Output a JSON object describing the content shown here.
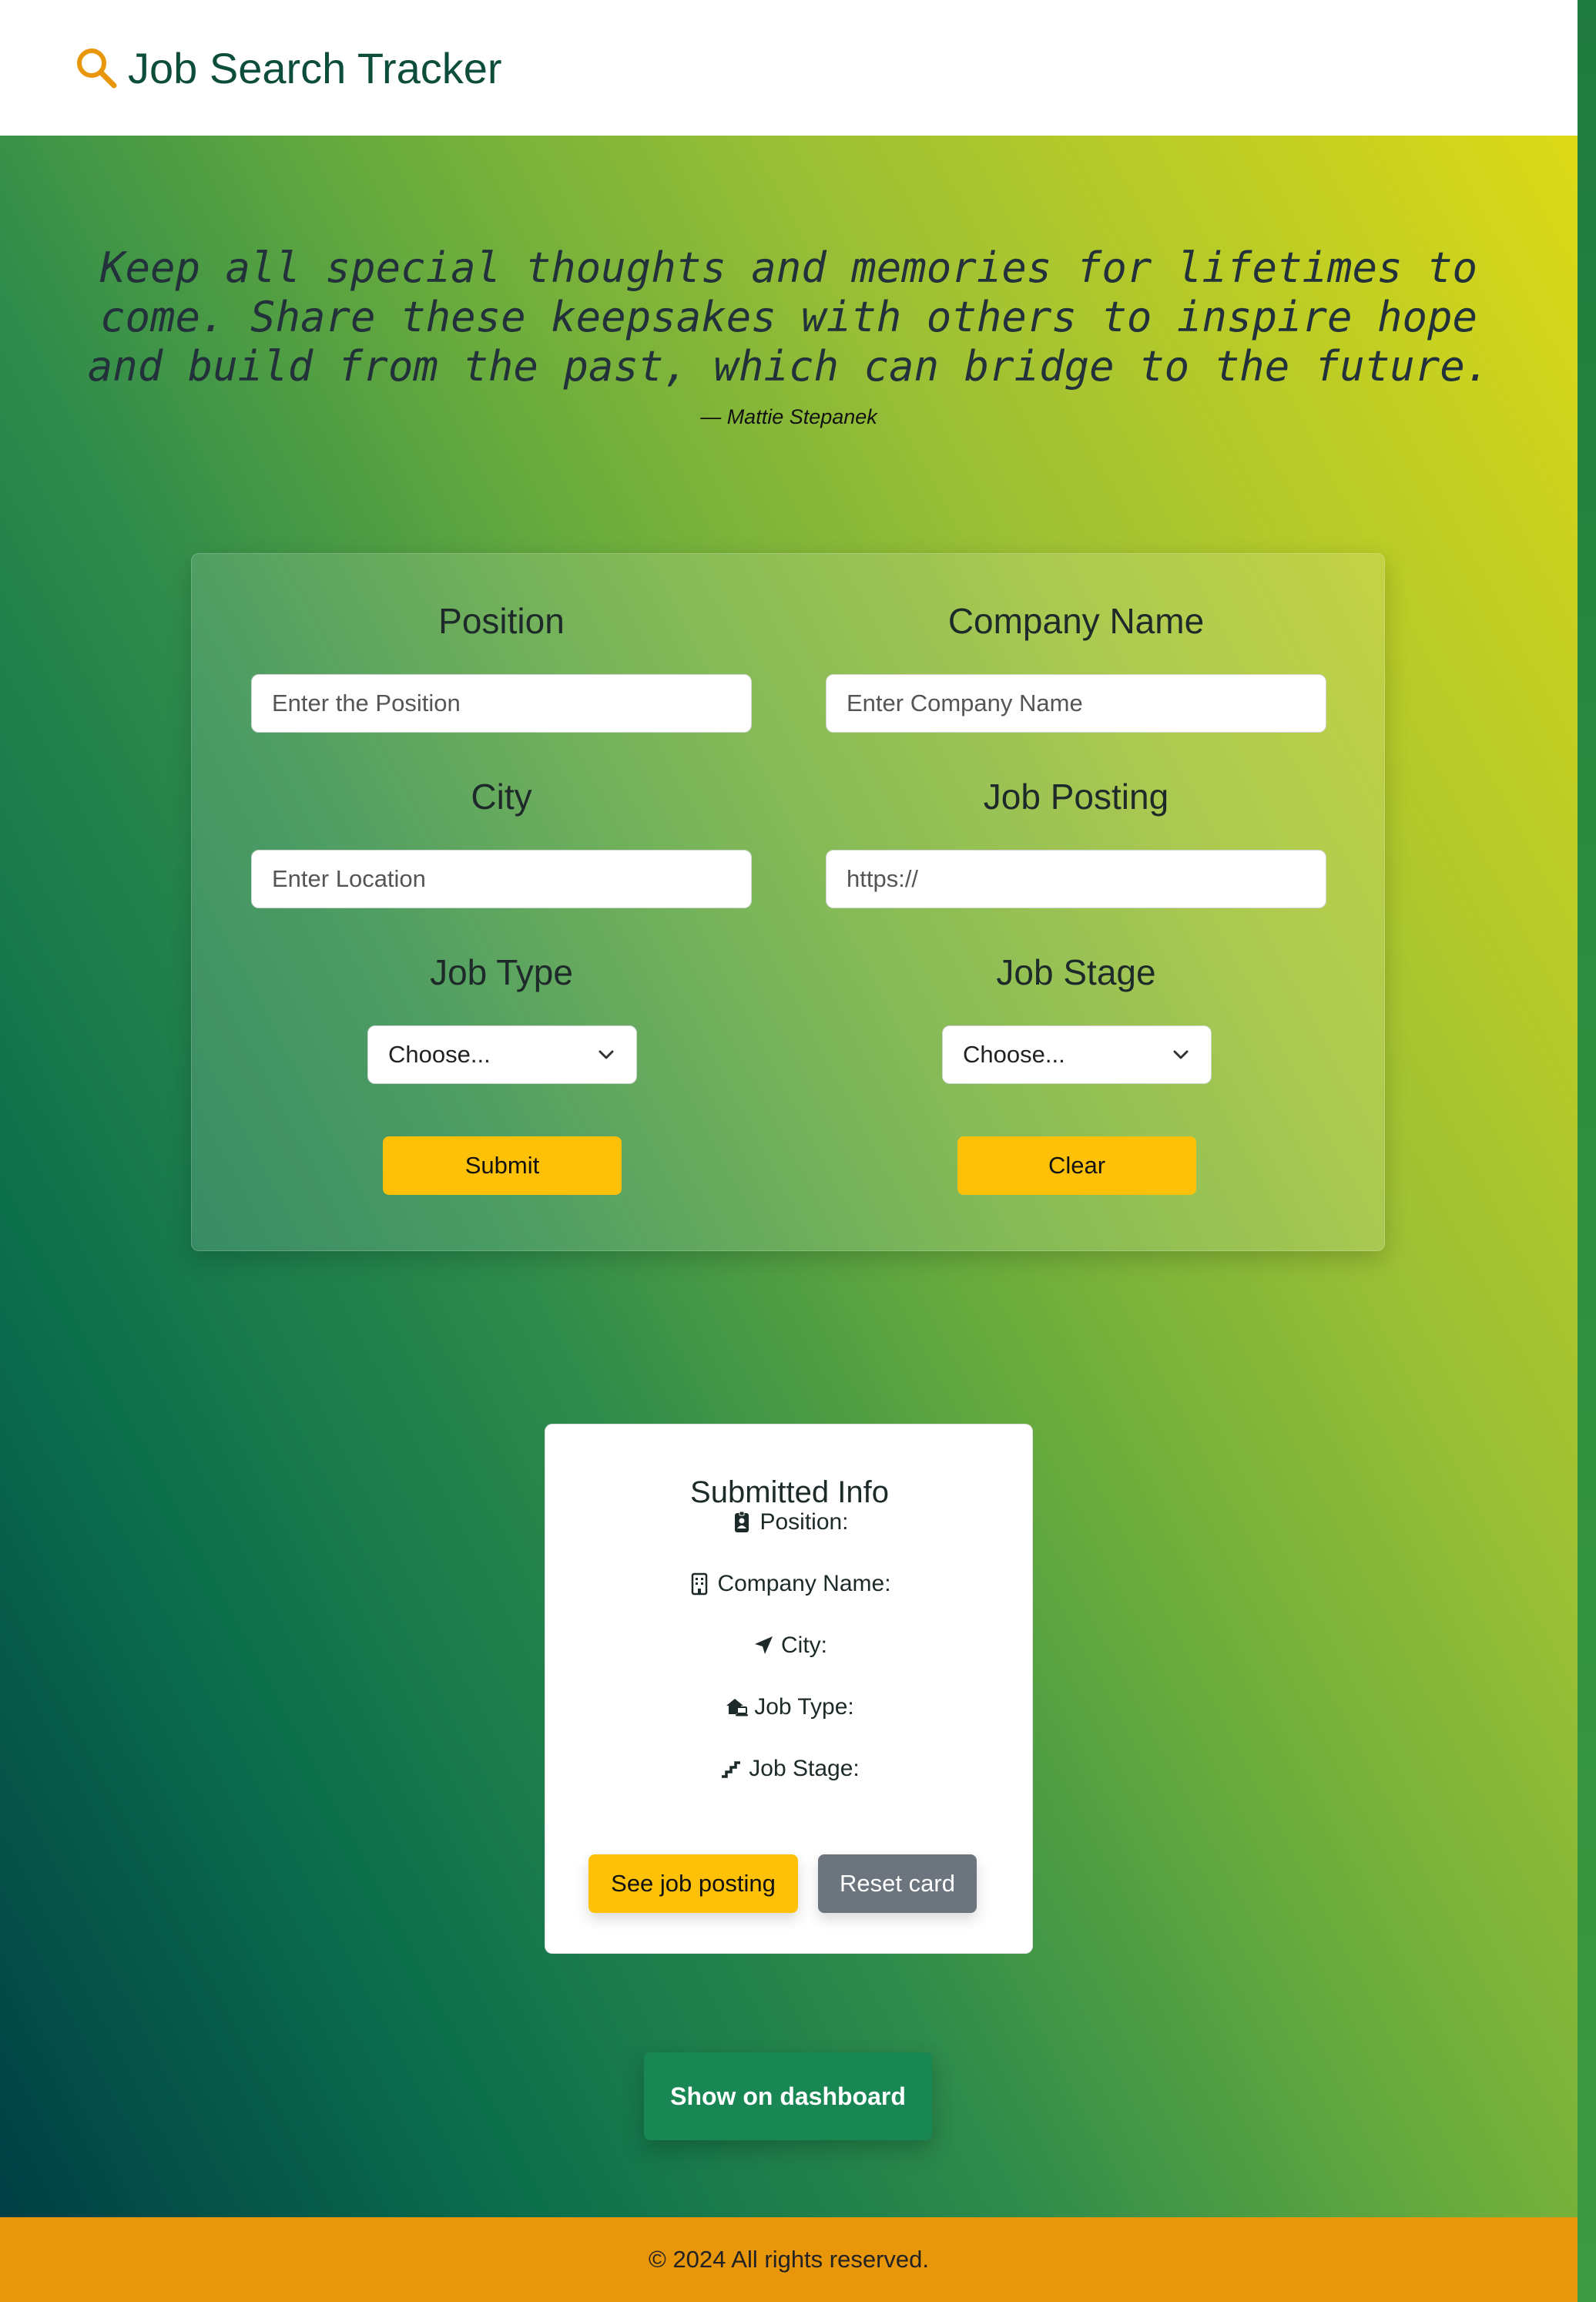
{
  "app": {
    "title": "Job Search Tracker",
    "brand_icon": "search-icon",
    "brand_color": "#e8960a"
  },
  "quote": {
    "text": "Keep all special thoughts and memories for lifetimes to come. Share these keepsakes with others to inspire hope and build from the past, which can bridge to the future.",
    "author": "— Mattie Stepanek"
  },
  "form": {
    "position": {
      "label": "Position",
      "placeholder": "Enter the Position",
      "value": ""
    },
    "company": {
      "label": "Company Name",
      "placeholder": "Enter Company Name",
      "value": ""
    },
    "city": {
      "label": "City",
      "placeholder": "Enter Location",
      "value": ""
    },
    "posting": {
      "label": "Job Posting",
      "placeholder": "https://",
      "value": ""
    },
    "job_type": {
      "label": "Job Type",
      "selected": "Choose..."
    },
    "job_stage": {
      "label": "Job Stage",
      "selected": "Choose..."
    },
    "submit_label": "Submit",
    "clear_label": "Clear"
  },
  "info": {
    "title": "Submitted Info",
    "rows": [
      {
        "icon": "id-badge-icon",
        "label": "Position:"
      },
      {
        "icon": "building-icon",
        "label": "Company Name:"
      },
      {
        "icon": "location-arrow-icon",
        "label": "City:"
      },
      {
        "icon": "house-laptop-icon",
        "label": "Job Type:"
      },
      {
        "icon": "stairs-icon",
        "label": "Job Stage:"
      }
    ],
    "see_posting_label": "See job posting",
    "reset_label": "Reset card"
  },
  "dashboard_label": "Show on dashboard",
  "footer": {
    "text": "© 2024 All rights reserved."
  },
  "colors": {
    "accent_yellow": "#ffc107",
    "secondary_gray": "#6c757d",
    "success_green": "#198754",
    "footer_orange": "#e8960a"
  }
}
